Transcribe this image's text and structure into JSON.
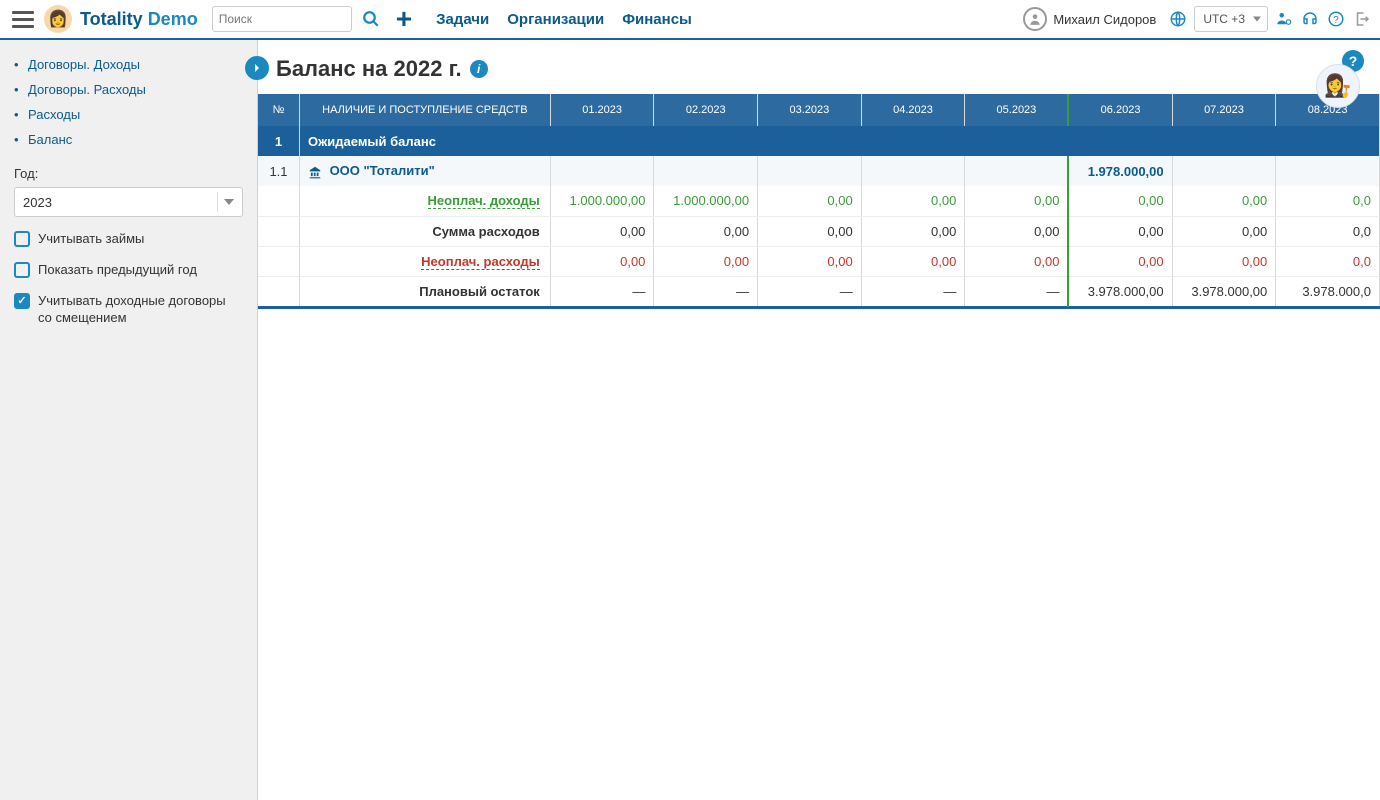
{
  "header": {
    "logo_a": "Totality",
    "logo_b": "Demo",
    "search_placeholder": "Поиск",
    "nav": [
      "Задачи",
      "Организации",
      "Финансы"
    ],
    "user_name": "Михаил Сидоров",
    "timezone": "UTC +3"
  },
  "sidebar": {
    "items": [
      "Договоры. Доходы",
      "Договоры. Расходы",
      "Расходы",
      "Баланс"
    ],
    "year_label": "Год:",
    "year_value": "2023",
    "cb1": "Учитывать займы",
    "cb1_checked": false,
    "cb2": "Показать предыдущий год",
    "cb2_checked": false,
    "cb3": "Учитывать доходные договоры со смещением",
    "cb3_checked": true
  },
  "page": {
    "title": "Баланс на 2022 г."
  },
  "table": {
    "head": {
      "num": "№",
      "label": "НАЛИЧИЕ И ПОСТУПЛЕНИЕ СРЕДСТВ",
      "months": [
        "01.2023",
        "02.2023",
        "03.2023",
        "04.2023",
        "05.2023",
        "06.2023",
        "07.2023",
        "08.2023"
      ]
    },
    "section": {
      "num": "1",
      "label": "Ожидаемый баланс"
    },
    "org": {
      "num": "1.1",
      "name": "ООО \"Тоталити\"",
      "highlight_val": "1.978.000,00"
    },
    "rows": [
      {
        "label": "Неоплач. доходы",
        "cls": "green-u",
        "valcls": "green",
        "vals": [
          "1.000.000,00",
          "1.000.000,00",
          "0,00",
          "0,00",
          "0,00",
          "0,00",
          "0,00",
          "0,0"
        ]
      },
      {
        "label": "Сумма расходов",
        "cls": "",
        "valcls": "",
        "vals": [
          "0,00",
          "0,00",
          "0,00",
          "0,00",
          "0,00",
          "0,00",
          "0,00",
          "0,0"
        ]
      },
      {
        "label": "Неоплач. расходы",
        "cls": "red-u",
        "valcls": "red",
        "vals": [
          "0,00",
          "0,00",
          "0,00",
          "0,00",
          "0,00",
          "0,00",
          "0,00",
          "0,0"
        ]
      },
      {
        "label": "Плановый остаток",
        "cls": "",
        "valcls": "",
        "vals": [
          "—",
          "—",
          "—",
          "—",
          "—",
          "3.978.000,00",
          "3.978.000,00",
          "3.978.000,0"
        ]
      }
    ]
  }
}
